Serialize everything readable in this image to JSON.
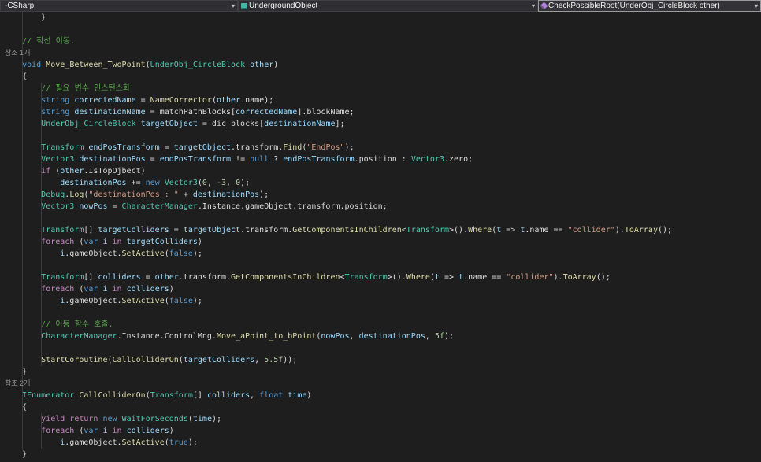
{
  "navbar": {
    "project_label": "-CSharp",
    "type_label": "UndergroundObject",
    "member_label": "CheckPossibleRoot(UnderObj_CircleBlock other)",
    "chevron_glyph": "▾"
  },
  "colors": {
    "background": "#1e1e1e",
    "navbar_background": "#2d2d30",
    "keyword": "#569cd6",
    "control_keyword": "#c586c0",
    "type": "#4ec9b0",
    "method": "#dcdcaa",
    "variable": "#9cdcfe",
    "string": "#d69d85",
    "number": "#b5cea8",
    "comment": "#57a64a",
    "plain_text": "#dcdcdc",
    "codelens_text": "#8f8f8f",
    "class_icon": "#43b8a6",
    "method_icon": "#b180d7"
  },
  "code": {
    "lines": [
      {
        "kind": "code",
        "tokens": [
          [
            "p",
            "        }"
          ]
        ]
      },
      {
        "kind": "blank"
      },
      {
        "kind": "code",
        "tokens": [
          [
            "cm",
            "    // 직선 이동."
          ]
        ]
      },
      {
        "kind": "lens",
        "text": "참조 1개"
      },
      {
        "kind": "code",
        "tokens": [
          [
            "p",
            "    "
          ],
          [
            "k",
            "void"
          ],
          [
            "p",
            " "
          ],
          [
            "m",
            "Move_Between_TwoPoint"
          ],
          [
            "p",
            "("
          ],
          [
            "t",
            "UnderObj_CircleBlock"
          ],
          [
            "p",
            " "
          ],
          [
            "v",
            "other"
          ],
          [
            "p",
            ")"
          ]
        ]
      },
      {
        "kind": "code",
        "tokens": [
          [
            "p",
            "    {"
          ]
        ]
      },
      {
        "kind": "code",
        "tokens": [
          [
            "cm",
            "        // 필요 변수 인스턴스화"
          ]
        ]
      },
      {
        "kind": "code",
        "tokens": [
          [
            "p",
            "        "
          ],
          [
            "k",
            "string"
          ],
          [
            "p",
            " "
          ],
          [
            "v",
            "correctedName"
          ],
          [
            "p",
            " = "
          ],
          [
            "m",
            "NameCorrector"
          ],
          [
            "p",
            "("
          ],
          [
            "v",
            "other"
          ],
          [
            "p",
            ".name);"
          ]
        ]
      },
      {
        "kind": "code",
        "tokens": [
          [
            "p",
            "        "
          ],
          [
            "k",
            "string"
          ],
          [
            "p",
            " "
          ],
          [
            "v",
            "destinationName"
          ],
          [
            "p",
            " = matchPathBlocks["
          ],
          [
            "v",
            "correctedName"
          ],
          [
            "p",
            "].blockName;"
          ]
        ]
      },
      {
        "kind": "code",
        "tokens": [
          [
            "p",
            "        "
          ],
          [
            "t",
            "UnderObj_CircleBlock"
          ],
          [
            "p",
            " "
          ],
          [
            "v",
            "targetObject"
          ],
          [
            "p",
            " = dic_blocks["
          ],
          [
            "v",
            "destinationName"
          ],
          [
            "p",
            "];"
          ]
        ]
      },
      {
        "kind": "blank"
      },
      {
        "kind": "code",
        "tokens": [
          [
            "p",
            "        "
          ],
          [
            "t",
            "Transform"
          ],
          [
            "p",
            " "
          ],
          [
            "v",
            "endPosTransform"
          ],
          [
            "p",
            " = "
          ],
          [
            "v",
            "targetObject"
          ],
          [
            "p",
            ".transform."
          ],
          [
            "m",
            "Find"
          ],
          [
            "p",
            "("
          ],
          [
            "s",
            "\"EndPos\""
          ],
          [
            "p",
            ");"
          ]
        ]
      },
      {
        "kind": "code",
        "tokens": [
          [
            "p",
            "        "
          ],
          [
            "t",
            "Vector3"
          ],
          [
            "p",
            " "
          ],
          [
            "v",
            "destinationPos"
          ],
          [
            "p",
            " = "
          ],
          [
            "v",
            "endPosTransform"
          ],
          [
            "p",
            " != "
          ],
          [
            "k",
            "null"
          ],
          [
            "p",
            " ? "
          ],
          [
            "v",
            "endPosTransform"
          ],
          [
            "p",
            ".position : "
          ],
          [
            "t",
            "Vector3"
          ],
          [
            "p",
            ".zero;"
          ]
        ]
      },
      {
        "kind": "code",
        "tokens": [
          [
            "p",
            "        "
          ],
          [
            "c",
            "if"
          ],
          [
            "p",
            " ("
          ],
          [
            "v",
            "other"
          ],
          [
            "p",
            ".IsTopOjbect)"
          ]
        ]
      },
      {
        "kind": "code",
        "tokens": [
          [
            "p",
            "            "
          ],
          [
            "v",
            "destinationPos"
          ],
          [
            "p",
            " += "
          ],
          [
            "k",
            "new"
          ],
          [
            "p",
            " "
          ],
          [
            "t",
            "Vector3"
          ],
          [
            "p",
            "("
          ],
          [
            "n",
            "0"
          ],
          [
            "p",
            ", "
          ],
          [
            "n",
            "-3"
          ],
          [
            "p",
            ", "
          ],
          [
            "n",
            "0"
          ],
          [
            "p",
            ");"
          ]
        ]
      },
      {
        "kind": "code",
        "tokens": [
          [
            "p",
            "        "
          ],
          [
            "t",
            "Debug"
          ],
          [
            "p",
            "."
          ],
          [
            "m",
            "Log"
          ],
          [
            "p",
            "("
          ],
          [
            "s",
            "\"destinationPos : \""
          ],
          [
            "p",
            " + "
          ],
          [
            "v",
            "destinationPos"
          ],
          [
            "p",
            ");"
          ]
        ]
      },
      {
        "kind": "code",
        "tokens": [
          [
            "p",
            "        "
          ],
          [
            "t",
            "Vector3"
          ],
          [
            "p",
            " "
          ],
          [
            "v",
            "nowPos"
          ],
          [
            "p",
            " = "
          ],
          [
            "t",
            "CharacterManager"
          ],
          [
            "p",
            ".Instance.gameObject.transform.position;"
          ]
        ]
      },
      {
        "kind": "blank"
      },
      {
        "kind": "code",
        "tokens": [
          [
            "p",
            "        "
          ],
          [
            "t",
            "Transform"
          ],
          [
            "p",
            "[] "
          ],
          [
            "v",
            "targetColliders"
          ],
          [
            "p",
            " = "
          ],
          [
            "v",
            "targetObject"
          ],
          [
            "p",
            ".transform."
          ],
          [
            "m",
            "GetComponentsInChildren"
          ],
          [
            "p",
            "<"
          ],
          [
            "t",
            "Transform"
          ],
          [
            "p",
            ">()."
          ],
          [
            "m",
            "Where"
          ],
          [
            "p",
            "("
          ],
          [
            "v",
            "t"
          ],
          [
            "p",
            " => "
          ],
          [
            "v",
            "t"
          ],
          [
            "p",
            ".name == "
          ],
          [
            "s",
            "\"collider\""
          ],
          [
            "p",
            ")."
          ],
          [
            "m",
            "ToArray"
          ],
          [
            "p",
            "();"
          ]
        ]
      },
      {
        "kind": "code",
        "tokens": [
          [
            "p",
            "        "
          ],
          [
            "c",
            "foreach"
          ],
          [
            "p",
            " ("
          ],
          [
            "k",
            "var"
          ],
          [
            "p",
            " "
          ],
          [
            "v",
            "i"
          ],
          [
            "p",
            " "
          ],
          [
            "c",
            "in"
          ],
          [
            "p",
            " "
          ],
          [
            "v",
            "targetColliders"
          ],
          [
            "p",
            ")"
          ]
        ]
      },
      {
        "kind": "code",
        "tokens": [
          [
            "p",
            "            "
          ],
          [
            "v",
            "i"
          ],
          [
            "p",
            ".gameObject."
          ],
          [
            "m",
            "SetActive"
          ],
          [
            "p",
            "("
          ],
          [
            "k",
            "false"
          ],
          [
            "p",
            ");"
          ]
        ]
      },
      {
        "kind": "blank"
      },
      {
        "kind": "code",
        "tokens": [
          [
            "p",
            "        "
          ],
          [
            "t",
            "Transform"
          ],
          [
            "p",
            "[] "
          ],
          [
            "v",
            "colliders"
          ],
          [
            "p",
            " = "
          ],
          [
            "v",
            "other"
          ],
          [
            "p",
            ".transform."
          ],
          [
            "m",
            "GetComponentsInChildren"
          ],
          [
            "p",
            "<"
          ],
          [
            "t",
            "Transform"
          ],
          [
            "p",
            ">()."
          ],
          [
            "m",
            "Where"
          ],
          [
            "p",
            "("
          ],
          [
            "v",
            "t"
          ],
          [
            "p",
            " => "
          ],
          [
            "v",
            "t"
          ],
          [
            "p",
            ".name == "
          ],
          [
            "s",
            "\"collider\""
          ],
          [
            "p",
            ")."
          ],
          [
            "m",
            "ToArray"
          ],
          [
            "p",
            "();"
          ]
        ]
      },
      {
        "kind": "code",
        "tokens": [
          [
            "p",
            "        "
          ],
          [
            "c",
            "foreach"
          ],
          [
            "p",
            " ("
          ],
          [
            "k",
            "var"
          ],
          [
            "p",
            " "
          ],
          [
            "v",
            "i"
          ],
          [
            "p",
            " "
          ],
          [
            "c",
            "in"
          ],
          [
            "p",
            " "
          ],
          [
            "v",
            "colliders"
          ],
          [
            "p",
            ")"
          ]
        ]
      },
      {
        "kind": "code",
        "tokens": [
          [
            "p",
            "            "
          ],
          [
            "v",
            "i"
          ],
          [
            "p",
            ".gameObject."
          ],
          [
            "m",
            "SetActive"
          ],
          [
            "p",
            "("
          ],
          [
            "k",
            "false"
          ],
          [
            "p",
            ");"
          ]
        ]
      },
      {
        "kind": "blank"
      },
      {
        "kind": "code",
        "tokens": [
          [
            "cm",
            "        // 이동 함수 호출."
          ]
        ]
      },
      {
        "kind": "code",
        "tokens": [
          [
            "p",
            "        "
          ],
          [
            "t",
            "CharacterManager"
          ],
          [
            "p",
            ".Instance.ControlMng."
          ],
          [
            "m",
            "Move_aPoint_to_bPoint"
          ],
          [
            "p",
            "("
          ],
          [
            "v",
            "nowPos"
          ],
          [
            "p",
            ", "
          ],
          [
            "v",
            "destinationPos"
          ],
          [
            "p",
            ", "
          ],
          [
            "n",
            "5f"
          ],
          [
            "p",
            ");"
          ]
        ]
      },
      {
        "kind": "blank"
      },
      {
        "kind": "code",
        "tokens": [
          [
            "p",
            "        "
          ],
          [
            "m",
            "StartCoroutine"
          ],
          [
            "p",
            "("
          ],
          [
            "m",
            "CallColliderOn"
          ],
          [
            "p",
            "("
          ],
          [
            "v",
            "targetColliders"
          ],
          [
            "p",
            ", "
          ],
          [
            "n",
            "5.5f"
          ],
          [
            "p",
            "));"
          ]
        ]
      },
      {
        "kind": "code",
        "tokens": [
          [
            "p",
            "    }"
          ]
        ]
      },
      {
        "kind": "lens",
        "text": "참조 2개"
      },
      {
        "kind": "code",
        "tokens": [
          [
            "p",
            "    "
          ],
          [
            "t",
            "IEnumerator"
          ],
          [
            "p",
            " "
          ],
          [
            "m",
            "CallColliderOn"
          ],
          [
            "p",
            "("
          ],
          [
            "t",
            "Transform"
          ],
          [
            "p",
            "[] "
          ],
          [
            "v",
            "colliders"
          ],
          [
            "p",
            ", "
          ],
          [
            "k",
            "float"
          ],
          [
            "p",
            " "
          ],
          [
            "v",
            "time"
          ],
          [
            "p",
            ")"
          ]
        ]
      },
      {
        "kind": "code",
        "tokens": [
          [
            "p",
            "    {"
          ]
        ]
      },
      {
        "kind": "code",
        "tokens": [
          [
            "p",
            "        "
          ],
          [
            "c",
            "yield"
          ],
          [
            "p",
            " "
          ],
          [
            "c",
            "return"
          ],
          [
            "p",
            " "
          ],
          [
            "k",
            "new"
          ],
          [
            "p",
            " "
          ],
          [
            "t",
            "WaitForSeconds"
          ],
          [
            "p",
            "("
          ],
          [
            "v",
            "time"
          ],
          [
            "p",
            ");"
          ]
        ]
      },
      {
        "kind": "code",
        "tokens": [
          [
            "p",
            "        "
          ],
          [
            "c",
            "foreach"
          ],
          [
            "p",
            " ("
          ],
          [
            "k",
            "var"
          ],
          [
            "p",
            " "
          ],
          [
            "v",
            "i"
          ],
          [
            "p",
            " "
          ],
          [
            "c",
            "in"
          ],
          [
            "p",
            " "
          ],
          [
            "v",
            "colliders"
          ],
          [
            "p",
            ")"
          ]
        ]
      },
      {
        "kind": "code",
        "tokens": [
          [
            "p",
            "            "
          ],
          [
            "v",
            "i"
          ],
          [
            "p",
            ".gameObject."
          ],
          [
            "m",
            "SetActive"
          ],
          [
            "p",
            "("
          ],
          [
            "k",
            "true"
          ],
          [
            "p",
            ");"
          ]
        ]
      },
      {
        "kind": "code",
        "tokens": [
          [
            "p",
            "    }"
          ]
        ]
      }
    ]
  }
}
